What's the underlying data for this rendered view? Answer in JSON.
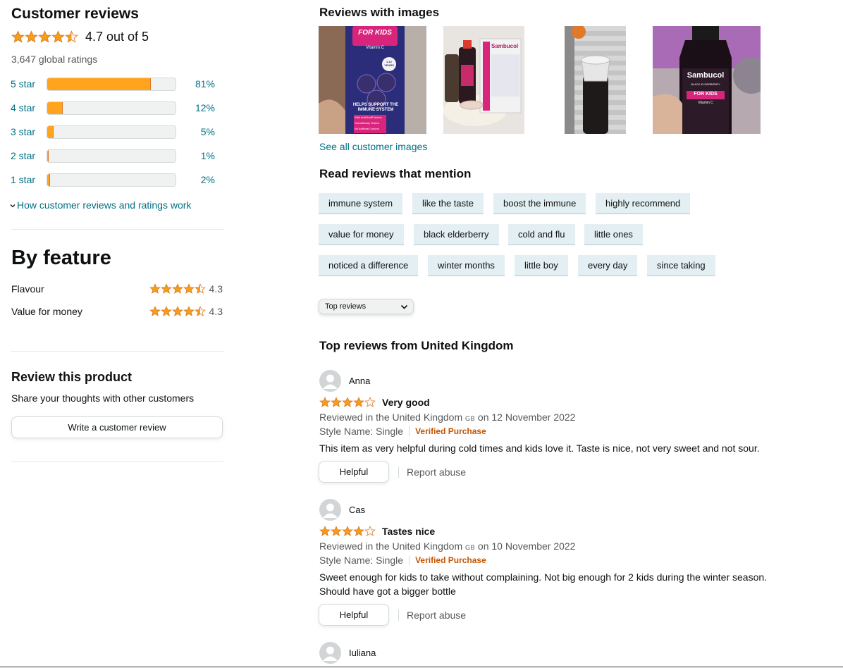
{
  "summary": {
    "title": "Customer reviews",
    "rating": 4.7,
    "rating_text": "4.7 out of 5",
    "global_ratings": "3,647 global ratings",
    "histogram": [
      {
        "label": "5 star",
        "percent": 81,
        "percent_text": "81%"
      },
      {
        "label": "4 star",
        "percent": 12,
        "percent_text": "12%"
      },
      {
        "label": "3 star",
        "percent": 5,
        "percent_text": "5%"
      },
      {
        "label": "2 star",
        "percent": 1,
        "percent_text": "1%"
      },
      {
        "label": "1 star",
        "percent": 2,
        "percent_text": "2%"
      }
    ],
    "how_link": "How customer reviews and ratings work"
  },
  "by_feature": {
    "title": "By feature",
    "items": [
      {
        "name": "Flavour",
        "rating": 4.3,
        "value_text": "4.3"
      },
      {
        "name": "Value for money",
        "rating": 4.3,
        "value_text": "4.3"
      }
    ]
  },
  "review_product": {
    "title": "Review this product",
    "subtitle": "Share your thoughts with other customers",
    "button": "Write a customer review"
  },
  "images": {
    "title": "Reviews with images",
    "see_all": "See all customer images",
    "thumb1_lines": [
      "FOR KIDS",
      "Vitamin C",
      "1-12 YEARS",
      "HELPS SUPPORT THE",
      "IMMUNE SYSTEM",
      "With AntiViral® Action",
      "Scientifically Tested",
      "No Artificial Colours"
    ],
    "thumb2_label": "Sambucol",
    "thumb4_lines": [
      "Sambucol",
      "BLACK ELDERBERRY",
      "FOR KIDS",
      "Vitamin C"
    ]
  },
  "mentions": {
    "title": "Read reviews that mention",
    "chips": [
      "immune system",
      "like the taste",
      "boost the immune",
      "highly recommend",
      "value for money",
      "black elderberry",
      "cold and flu",
      "little ones",
      "noticed a difference",
      "winter months",
      "little boy",
      "every day",
      "since taking"
    ]
  },
  "sort": {
    "selected": "Top reviews"
  },
  "top_reviews": {
    "title": "Top reviews from United Kingdom",
    "reviews": [
      {
        "name": "Anna",
        "stars": 4,
        "title": "Very good",
        "meta_prefix": "Reviewed in the United Kingdom",
        "country_code": "GB",
        "meta_date": "on 12 November 2022",
        "style": "Style Name: Single",
        "verified": "Verified Purchase",
        "body": "This item as very helpful during cold times and kids love it. Taste is nice, not very sweet and not sour.",
        "helpful": "Helpful",
        "report": "Report abuse"
      },
      {
        "name": "Cas",
        "stars": 4,
        "title": "Tastes nice",
        "meta_prefix": "Reviewed in the United Kingdom",
        "country_code": "GB",
        "meta_date": "on 10 November 2022",
        "style": "Style Name: Single",
        "verified": "Verified Purchase",
        "body_line1": "Sweet enough for kids to take without complaining. Not big enough for 2 kids during the winter season.",
        "body_line2": "Should have got a bigger bottle",
        "helpful": "Helpful",
        "report": "Report abuse"
      },
      {
        "name": "Iuliana"
      }
    ]
  },
  "colors": {
    "star": "#de7921",
    "bar_fill": "#ffa41c",
    "link": "#007185",
    "verified": "#c45500",
    "chip_bg": "#e3eff2"
  }
}
